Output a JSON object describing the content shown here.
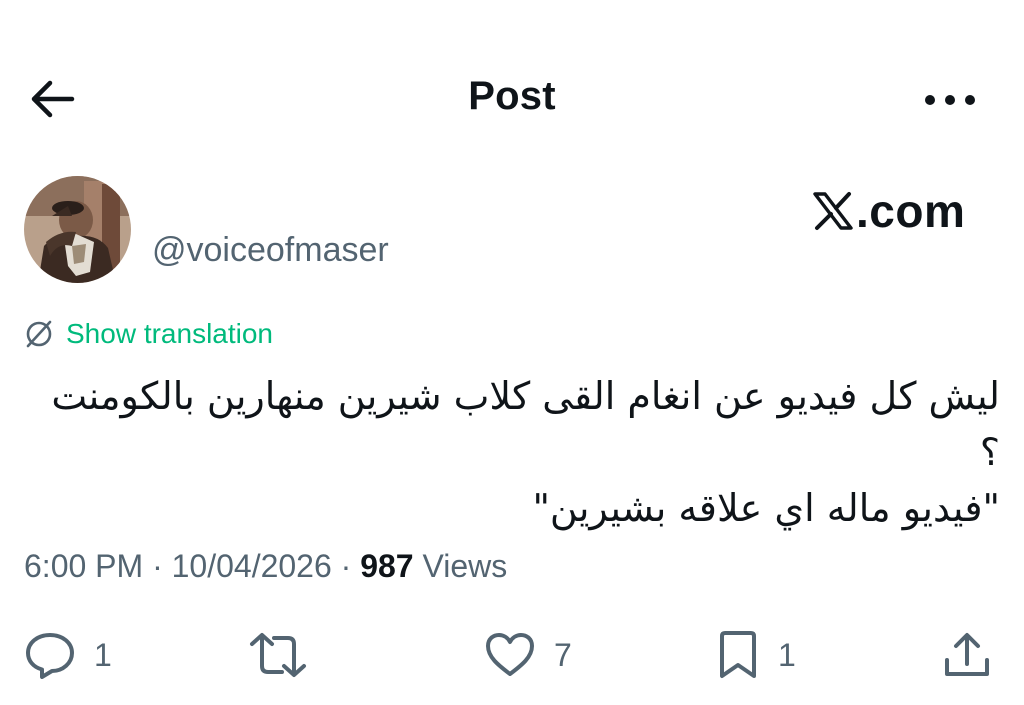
{
  "header": {
    "title": "Post",
    "back_icon": "arrow-left-icon",
    "more_icon": "more-horizontal-icon"
  },
  "brand": {
    "text": ".com",
    "icon": "x-logo-icon"
  },
  "author": {
    "handle": "@voiceofmaser"
  },
  "translation": {
    "label": "Show translation",
    "icon": "translate-icon"
  },
  "post": {
    "line1": "ليش كل فيديو عن انغام القى كلاب شيرين منهارين بالكومنت ؟",
    "line2": "\"فيديو ماله اي علاقه بشيرين\""
  },
  "meta": {
    "time": "6:00 PM",
    "separator": "·",
    "date": "10/04/2026",
    "views_count": "987",
    "views_label": "Views"
  },
  "actions": {
    "reply": {
      "icon": "reply-icon",
      "count": "1"
    },
    "repost": {
      "icon": "repost-icon"
    },
    "like": {
      "icon": "heart-icon",
      "count": "7"
    },
    "bookmark": {
      "icon": "bookmark-icon",
      "count": "1"
    },
    "share": {
      "icon": "share-icon"
    }
  },
  "colors": {
    "text": "#0f1419",
    "secondary": "#536471",
    "translate": "#00ba7c",
    "background": "#ffffff"
  }
}
